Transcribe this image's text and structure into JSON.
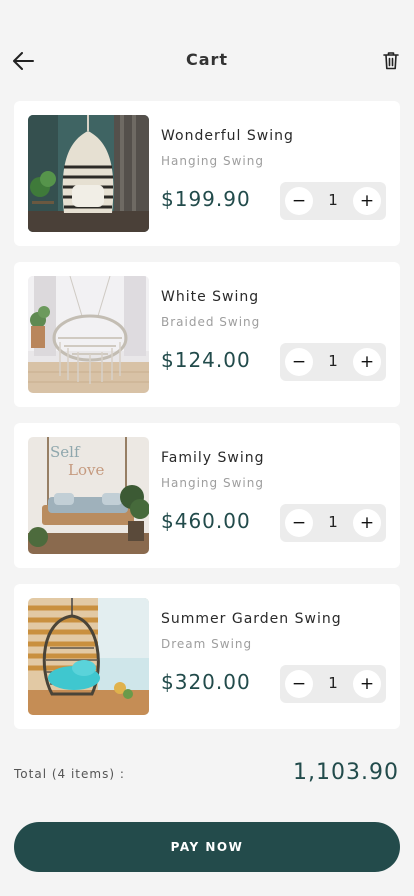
{
  "header": {
    "title": "Cart",
    "back_icon": "arrow-left-icon",
    "trash_icon": "trash-icon"
  },
  "items": [
    {
      "name": "Wonderful Swing",
      "subtitle": "Hanging Swing",
      "price": "$199.90",
      "quantity": "1"
    },
    {
      "name": "White Swing",
      "subtitle": "Braided Swing",
      "price": "$124.00",
      "quantity": "1"
    },
    {
      "name": "Family Swing",
      "subtitle": "Hanging Swing",
      "price": "$460.00",
      "quantity": "1"
    },
    {
      "name": "Summer Garden Swing",
      "subtitle": "Dream Swing",
      "price": "$320.00",
      "quantity": "1"
    }
  ],
  "stepper": {
    "minus": "−",
    "plus": "+"
  },
  "photo_text": {
    "wall_sign_line1": "Self",
    "wall_sign_line2": "Love"
  },
  "total": {
    "label": "Total (4 items) :",
    "value": "1,103.90"
  },
  "pay_button": {
    "label": "PAY NOW"
  },
  "colors": {
    "accent": "#234b4b",
    "price": "#224b4b",
    "background": "#f4f4f4",
    "card": "#ffffff"
  }
}
